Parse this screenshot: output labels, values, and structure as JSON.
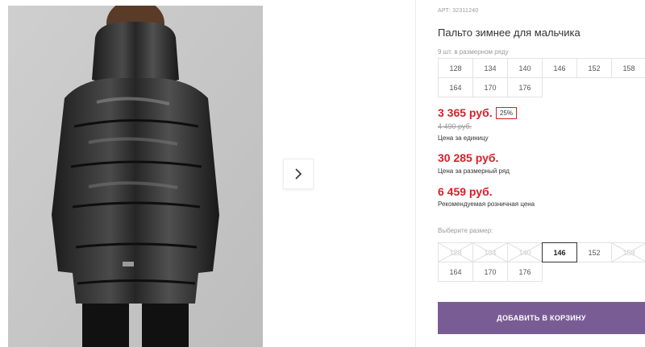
{
  "product": {
    "sku_label": "АРТ: 32311240",
    "title": "Пальто зимнее для мальчика",
    "series_note": "9 шт. в размерном ряду"
  },
  "series_sizes": [
    "128",
    "134",
    "140",
    "146",
    "152",
    "158",
    "164",
    "170",
    "176"
  ],
  "pricing": {
    "unit_price": "3 365 руб.",
    "discount": "25%",
    "old_price": "4 490 руб.",
    "unit_label": "Цена за единицу",
    "row_price": "30 285 руб.",
    "row_label": "Цена за размерный ряд",
    "rrp_price": "6 459 руб.",
    "rrp_label": "Рекомендуемая розничная цена"
  },
  "size_picker": {
    "label": "Выберите размер:",
    "sizes": [
      {
        "label": "128",
        "state": "disabled"
      },
      {
        "label": "134",
        "state": "disabled"
      },
      {
        "label": "140",
        "state": "disabled"
      },
      {
        "label": "146",
        "state": "selected"
      },
      {
        "label": "152",
        "state": "available"
      },
      {
        "label": "158",
        "state": "disabled"
      },
      {
        "label": "164",
        "state": "available"
      },
      {
        "label": "170",
        "state": "available"
      },
      {
        "label": "176",
        "state": "available"
      }
    ]
  },
  "cart": {
    "add_label": "ДОБАВИТЬ В КОРЗИНУ"
  },
  "gallery": {
    "next_icon": "chevron-right-icon"
  },
  "colors": {
    "accent": "#7a5c95",
    "price": "#d71f28"
  }
}
